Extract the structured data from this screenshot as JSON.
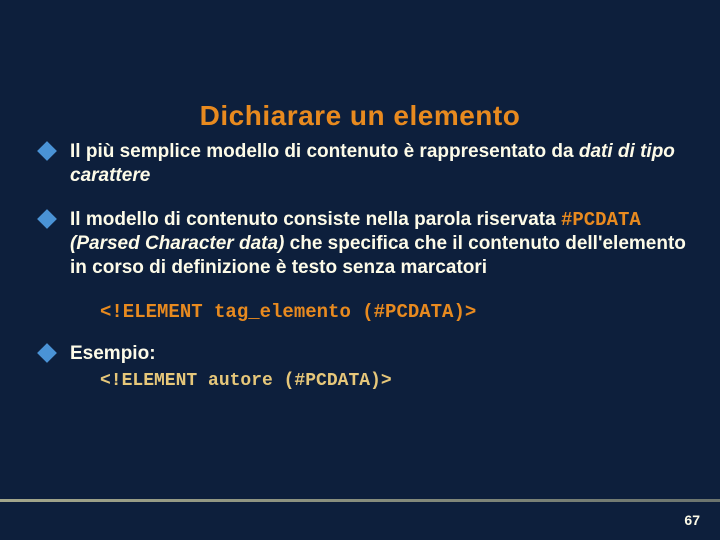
{
  "title": "Dichiarare un elemento",
  "bullets": [
    {
      "text_prefix": "Il più semplice modello di contenuto è rappresentato da ",
      "italic": "dati di tipo carattere",
      "text_mid": "",
      "keyword": "",
      "paren": "",
      "text_suffix": ""
    },
    {
      "text_prefix": "Il modello di contenuto consiste nella parola riservata ",
      "italic": "",
      "text_mid": "",
      "keyword": "#PCDATA",
      "paren": " (Parsed Character data)",
      "text_suffix": " che specifica che il contenuto dell'elemento in corso di definizione è testo senza marcatori"
    }
  ],
  "syntax_code": "<!ELEMENT tag_elemento (#PCDATA)>",
  "example_label": "Esempio:",
  "example_code": "<!ELEMENT autore (#PCDATA)>",
  "page_number": "67"
}
